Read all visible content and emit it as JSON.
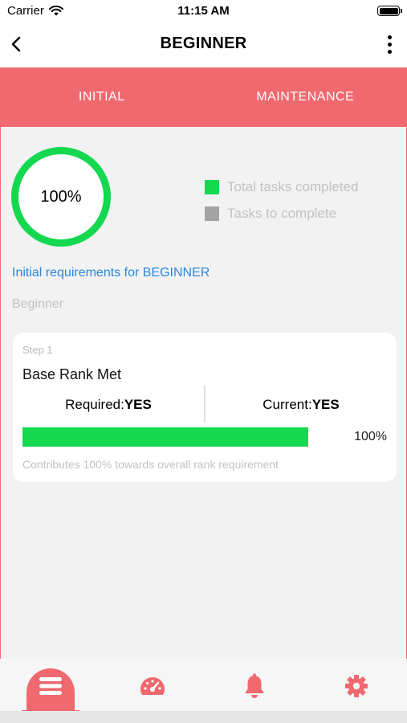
{
  "status_bar": {
    "carrier": "Carrier",
    "time": "11:15 AM"
  },
  "nav": {
    "title": "BEGINNER"
  },
  "tabs": [
    {
      "label": "INITIAL"
    },
    {
      "label": "MAINTENANCE"
    }
  ],
  "summary": {
    "percent_label": "100%",
    "progress": 1.0,
    "legend": [
      {
        "label": "Total tasks completed",
        "color": "#14d84f"
      },
      {
        "label": "Tasks to complete",
        "color": "#a3a3a3"
      }
    ]
  },
  "requirements_link": "Initial requirements for BEGINNER",
  "rank_name": "Beginner",
  "card": {
    "step": "Step 1",
    "name": "Base Rank Met",
    "required_label": "Required:",
    "required_value": "YES",
    "current_label": "Current:",
    "current_value": "YES",
    "progress": 1.0,
    "percent_label": "100%",
    "note": "Contributes 100% towards overall rank requirement"
  },
  "tab_bar": {
    "items": [
      {
        "icon": "list-icon",
        "active": true
      },
      {
        "icon": "speedometer-icon",
        "active": false
      },
      {
        "icon": "bell-icon",
        "active": false
      },
      {
        "icon": "gear-icon",
        "active": false
      }
    ]
  },
  "colors": {
    "accent": "#f0696f",
    "success": "#14d84f",
    "link": "#2b86d9",
    "background": "#f2f2f2"
  }
}
